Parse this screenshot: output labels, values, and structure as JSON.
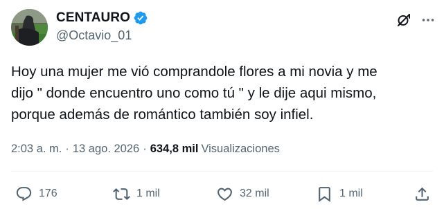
{
  "author": {
    "display_name": "CENTAURO",
    "handle": "@Octavio_01",
    "verified": true
  },
  "tweet": {
    "lines": [
      "Hoy una mujer me vió comprandole flores a mi novia y me",
      "dijo \" donde encuentro uno como tú \" y le dije aqui mismo,",
      "porque además de romántico también soy infiel."
    ],
    "time": "2:03 a. m.",
    "separator": "·",
    "date": "13 ago. 2026",
    "views_count": "634,8 mil",
    "views_label": "Visualizaciones"
  },
  "actions": {
    "replies": "176",
    "reposts": "1 mil",
    "likes": "32 mil",
    "bookmarks": "1 mil"
  },
  "icons": {
    "verified": "verified-badge-icon",
    "grok": "grok-icon",
    "more": "more-options-icon",
    "reply": "reply-icon",
    "repost": "repost-icon",
    "like": "heart-icon",
    "bookmark": "bookmark-icon",
    "share": "share-icon"
  },
  "colors": {
    "text": "#0f1419",
    "secondary": "#536471",
    "verified": "#1d9bf0",
    "divider": "#eff3f4"
  }
}
